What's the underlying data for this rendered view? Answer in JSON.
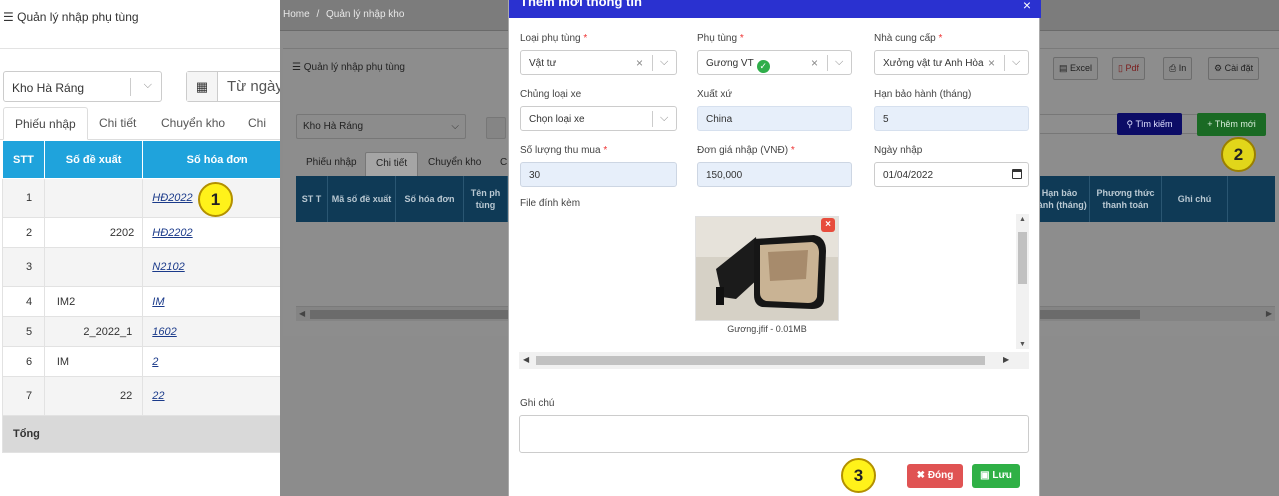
{
  "left": {
    "page_title": "Quản lý nhập phụ tùng",
    "warehouse": "Kho Hà Ráng",
    "date_placeholder": "Từ ngày",
    "tabs": [
      "Phiếu nhập",
      "Chi tiết",
      "Chuyển kho",
      "Chi tiế"
    ],
    "table": {
      "headers": [
        "STT",
        "Số đề xuất",
        "Số hóa đơn"
      ],
      "rows": [
        {
          "stt": "1",
          "de_xuat": "",
          "hoa_don": "HĐ2022"
        },
        {
          "stt": "2",
          "de_xuat": "2202",
          "hoa_don": "HĐ2202"
        },
        {
          "stt": "3",
          "de_xuat": "",
          "hoa_don": "N2102"
        },
        {
          "stt": "4",
          "de_xuat": "IM2",
          "hoa_don": "IM"
        },
        {
          "stt": "5",
          "de_xuat": "2_2022_1",
          "hoa_don": "1602"
        },
        {
          "stt": "6",
          "de_xuat": "IM",
          "hoa_don": "2"
        },
        {
          "stt": "7",
          "de_xuat": "22",
          "hoa_don": "22"
        }
      ],
      "total_label": "Tổng"
    }
  },
  "mid": {
    "breadcrumb": {
      "home": "Home",
      "sep": "/",
      "current": "Quản lý nhập kho"
    },
    "card_title": "Quản lý nhập phụ tùng",
    "toolbar": {
      "excel": "Excel",
      "pdf": "Pdf",
      "print": "In",
      "settings": "Cài đặt"
    },
    "warehouse": "Kho Hà Ráng",
    "search_button": "Tìm kiếm",
    "add_button": "Thêm mới",
    "tabs": [
      "Phiếu nhập",
      "Chi tiết",
      "Chuyển kho",
      "C"
    ],
    "table_headers": [
      "ST T",
      "Mã số đề xuất",
      "Số hóa đơn",
      "Tên ph tùng",
      "Hạn bảo hành (tháng)",
      "Phương thức thanh toán",
      "Ghi chú"
    ]
  },
  "modal": {
    "title": "Thêm mới thông tin",
    "close": "×",
    "fields": {
      "loai_phu_tung": {
        "label": "Loại phụ tùng",
        "required": "*",
        "value": "Vật tư"
      },
      "phu_tung": {
        "label": "Phụ tùng",
        "required": "*",
        "value": "Gương VT"
      },
      "nha_cung_cap": {
        "label": "Nhà cung cấp",
        "required": "*",
        "value": "Xưởng vật tư Anh Hòa"
      },
      "chung_loai_xe": {
        "label": "Chủng loại xe",
        "value": "Chọn loại xe"
      },
      "xuat_xu": {
        "label": "Xuất xứ",
        "value": "China"
      },
      "han_bao_hanh": {
        "label": "Hạn bảo hành (tháng)",
        "value": "5"
      },
      "so_luong": {
        "label": "Số lượng thu mua",
        "required": "*",
        "value": "30"
      },
      "don_gia": {
        "label": "Đơn giá nhập (VNĐ)",
        "required": "*",
        "value": "150,000"
      },
      "ngay_nhap": {
        "label": "Ngày nhập",
        "value": "01/04/2022"
      }
    },
    "attachment": {
      "label": "File đính kèm",
      "caption": "Gương.jfif - 0.01MB"
    },
    "note_label": "Ghi chú",
    "buttons": {
      "close": "Đóng",
      "save": "Lưu"
    }
  },
  "markers": [
    "1",
    "2",
    "3"
  ],
  "colors": {
    "table_header": "#1fa3dc",
    "modal_header": "#2a31d0",
    "marker": "#fff21a",
    "btn_close": "#e05353",
    "btn_save": "#2fb046"
  }
}
